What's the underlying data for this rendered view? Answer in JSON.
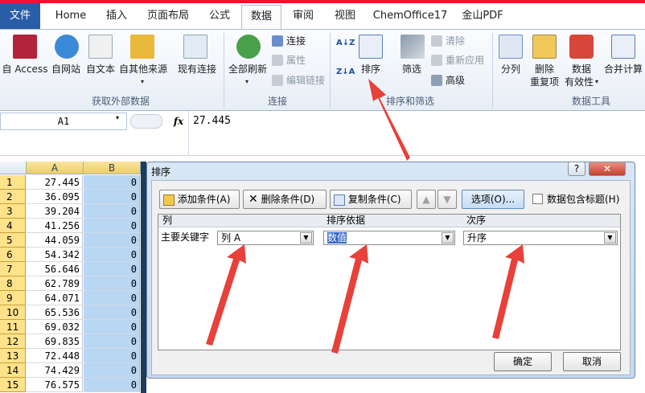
{
  "tabs": [
    "文件",
    "Home",
    "插入",
    "页面布局",
    "公式",
    "数据",
    "审阅",
    "视图",
    "ChemOffice17",
    "金山PDF"
  ],
  "ribbon": {
    "access": "自 Access",
    "web": "自网站",
    "text": "自文本",
    "other": "自其他来源",
    "existing": "现有连接",
    "group_external": "获取外部数据",
    "refresh_all": "全部刷新",
    "connections": "连接",
    "properties": "属性",
    "edit_links": "编辑链接",
    "group_connections": "连接",
    "sort": "排序",
    "filter": "筛选",
    "clear": "清除",
    "reapply": "重新应用",
    "advanced": "高级",
    "group_sort_filter": "排序和筛选",
    "split_col": "分列",
    "remove_dup_1": "删除",
    "remove_dup_2": "重复项",
    "validation_1": "数据",
    "validation_2": "有效性",
    "consolidate": "合并计算",
    "group_data_tools": "数据工具"
  },
  "formula_bar": {
    "namebox": "A1",
    "fx": "fx",
    "value": "27.445"
  },
  "columns": [
    "A",
    "B"
  ],
  "rows": [
    {
      "n": "1",
      "a": "27.445",
      "b": "0"
    },
    {
      "n": "2",
      "a": "36.095",
      "b": "0"
    },
    {
      "n": "3",
      "a": "39.204",
      "b": "0"
    },
    {
      "n": "4",
      "a": "41.256",
      "b": "0"
    },
    {
      "n": "5",
      "a": "44.059",
      "b": "0"
    },
    {
      "n": "6",
      "a": "54.342",
      "b": "0"
    },
    {
      "n": "7",
      "a": "56.646",
      "b": "0"
    },
    {
      "n": "8",
      "a": "62.789",
      "b": "0"
    },
    {
      "n": "9",
      "a": "64.071",
      "b": "0"
    },
    {
      "n": "10",
      "a": "65.536",
      "b": "0"
    },
    {
      "n": "11",
      "a": "69.032",
      "b": "0"
    },
    {
      "n": "12",
      "a": "69.835",
      "b": "0"
    },
    {
      "n": "13",
      "a": "72.448",
      "b": "0"
    },
    {
      "n": "14",
      "a": "74.429",
      "b": "0"
    },
    {
      "n": "15",
      "a": "76.575",
      "b": "0"
    }
  ],
  "dialog": {
    "title": "排序",
    "help": "?",
    "close": "✕",
    "add_level": "添加条件(A)",
    "delete_level": "删除条件(D)",
    "copy_level": "复制条件(C)",
    "options": "选项(O)...",
    "has_headers": "数据包含标题(H)",
    "header_column": "列",
    "header_sort_on": "排序依据",
    "header_order": "次序",
    "row_label": "主要关键字",
    "column_value": "列 A",
    "sort_on_value": "数值",
    "order_value": "升序",
    "ok": "确定",
    "cancel": "取消"
  },
  "colors": {
    "file_tab": "#2a5da8",
    "top_line": "#e8172c",
    "arrow": "#e8403a",
    "row_header": "#ffe28a",
    "selection": "#b9d6f3"
  }
}
